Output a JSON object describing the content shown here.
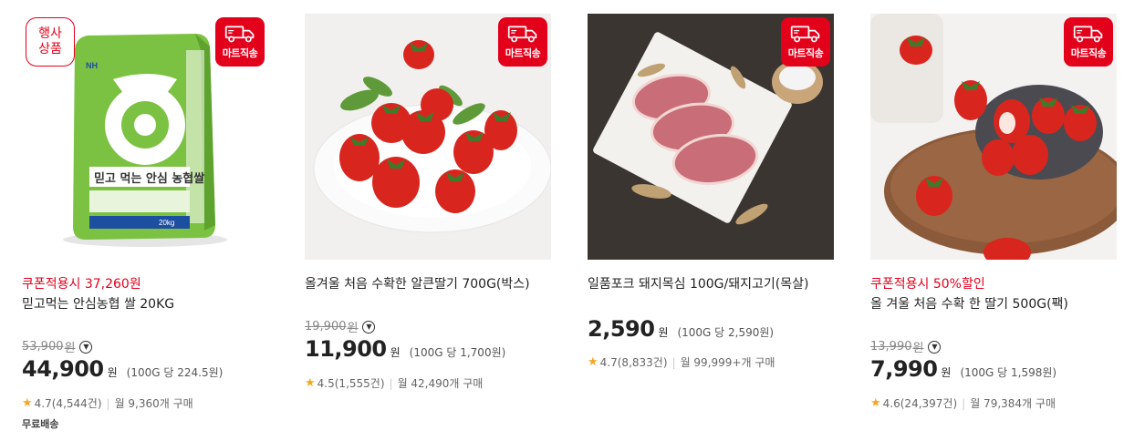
{
  "badges": {
    "mart_delivery": "마트직송",
    "event_product": "행사상품"
  },
  "icons": {
    "truck": "truck-icon",
    "star": "star-icon",
    "dropdown": "chevron-down-circle-icon"
  },
  "colors": {
    "accent_red": "#e3001b",
    "star_yellow": "#f5a623"
  },
  "products": [
    {
      "coupon": "쿠폰적용시 37,260원",
      "title": "믿고먹는 안심농협 쌀 20KG",
      "original_price": "53,900",
      "original_won": "원",
      "price": "44,900",
      "won": "원",
      "unit_price": "(100G 당 224.5원)",
      "rating": "4.7",
      "reviews": "(4,544건)",
      "monthly_sales": "월 9,360개 구매",
      "shipping": "무료배송",
      "bag_brand": "NH",
      "bag_title": "믿고 먹는 안심 농협쌀",
      "bag_weight": "20kg"
    },
    {
      "title": "올겨울 처음 수확한 알큰딸기 700G(박스)",
      "original_price": "19,900",
      "original_won": "원",
      "price": "11,900",
      "won": "원",
      "unit_price": "(100G 당 1,700원)",
      "rating": "4.5",
      "reviews": "(1,555건)",
      "monthly_sales": "월 42,490개 구매"
    },
    {
      "title": "일품포크 돼지목심 100G/돼지고기(목살)",
      "price": "2,590",
      "won": "원",
      "unit_price": "(100G 당 2,590원)",
      "rating": "4.7",
      "reviews": "(8,833건)",
      "monthly_sales": "월 99,999+개 구매"
    },
    {
      "coupon": "쿠폰적용시 50%할인",
      "title": "올 겨울 처음 수확 한 딸기 500G(팩)",
      "original_price": "13,990",
      "original_won": "원",
      "price": "7,990",
      "won": "원",
      "unit_price": "(100G 당 1,598원)",
      "rating": "4.6",
      "reviews": "(24,397건)",
      "monthly_sales": "월 79,384개 구매"
    }
  ]
}
